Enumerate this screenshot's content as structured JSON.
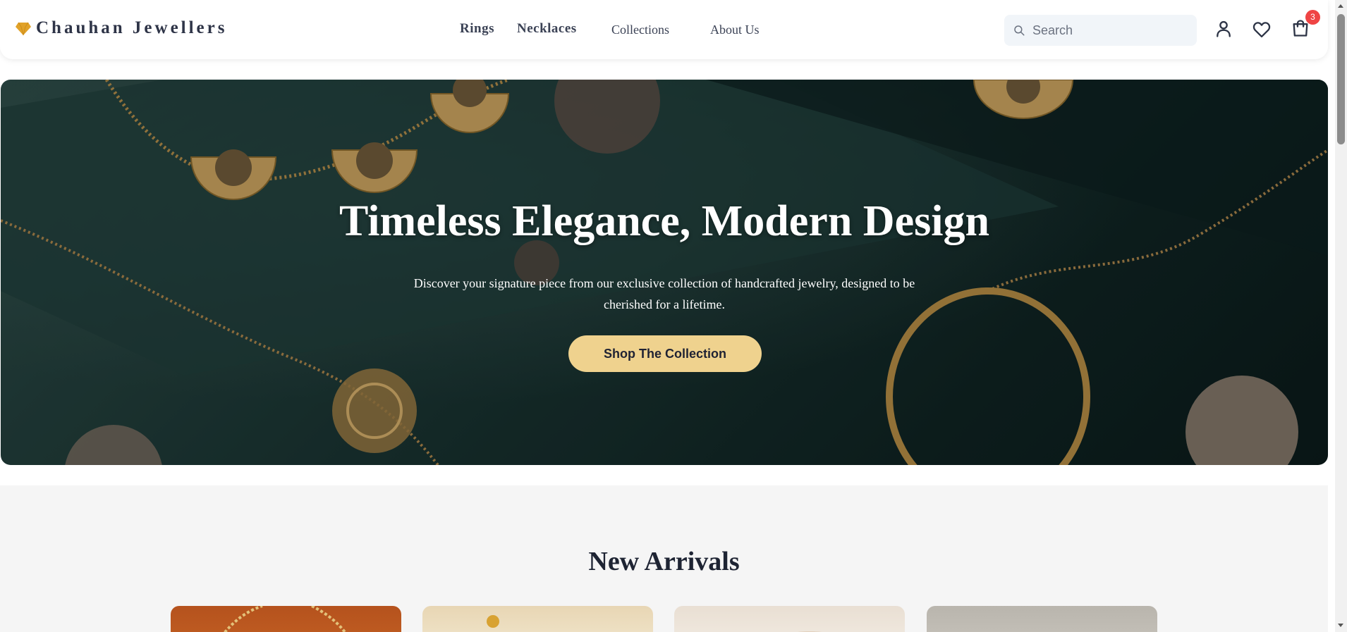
{
  "header": {
    "brand": "Chauhan Jewellers",
    "nav": {
      "rings": "Rings",
      "necklaces": "Necklaces",
      "collections": "Collections",
      "about": "About Us"
    },
    "search": {
      "placeholder": "Search",
      "value": ""
    },
    "icons": [
      "diamond-icon",
      "search-icon",
      "user-icon",
      "heart-icon",
      "cart-icon"
    ],
    "cart_count": "3"
  },
  "hero": {
    "title": "Timeless Elegance, Modern Design",
    "subtitle": "Discover your signature piece from our exclusive collection of handcrafted jewelry, designed to be cherished for a lifetime.",
    "cta": "Shop The Collection"
  },
  "arrivals": {
    "title": "New Arrivals"
  },
  "colors": {
    "accent": "#efd28e",
    "logo_gem": "#e1a229",
    "badge": "#ef4444",
    "hero_bg": "#1a3432",
    "text_dark": "#1e2433"
  }
}
